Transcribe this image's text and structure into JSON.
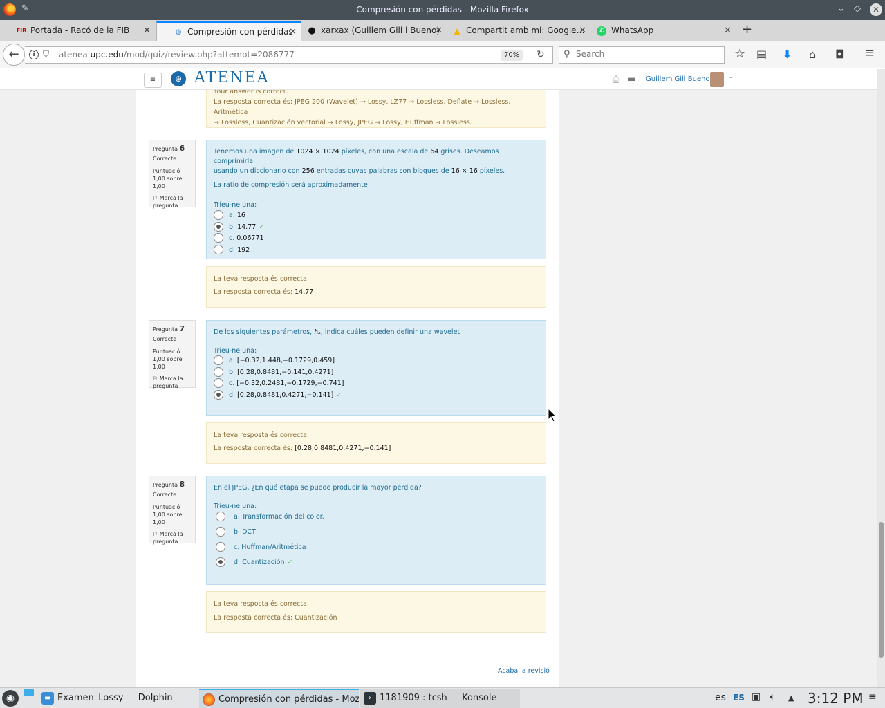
{
  "window": {
    "title": "Compresión con pérdidas - Mozilla Firefox"
  },
  "tabs": [
    {
      "label": "Portada - Racó de la FIB",
      "icon": "fib-icon"
    },
    {
      "label": "Compresión con pérdidas",
      "icon": "globe-icon"
    },
    {
      "label": "xarxax (Guillem Gili i Bueno)",
      "icon": "github-icon"
    },
    {
      "label": "Compartit amb mi: Google…",
      "icon": "google-drive-icon"
    },
    {
      "label": "WhatsApp",
      "icon": "whatsapp-icon"
    }
  ],
  "navbar": {
    "url_prefix": "atenea.",
    "url_domain": "upc.edu",
    "url_path": "/mod/quiz/review.php?attempt=2086777",
    "zoom": "70%",
    "search_placeholder": "Search"
  },
  "moodle": {
    "menu_icon": "≡",
    "logo_text": "ATENEA",
    "user_name": "Guillem Gili Bueno",
    "caret": "-"
  },
  "prev_feedback": {
    "line1": "Your answer is correct.",
    "line2": "La resposta correcta és: JPEG 200 (Wavelet)  → Lossy, LZ77 → Lossless, Deflate → Lossless, Aritmética",
    "line3": "→ Lossless, Cuantización vectorial → Lossy, JPEG → Lossy, Huffman → Lossless."
  },
  "questions": [
    {
      "label": "Pregunta",
      "number": "6",
      "state": "Correcte",
      "grade": "Puntuació 1,00 sobre 1,00",
      "flag": "Marca la pregunta",
      "text_parts": [
        "Tenemos una imagen de ",
        "1024 × 1024",
        " píxeles, con una escala de ",
        "64",
        " grises. Deseamos comprimirla",
        "usando un diccionario con ",
        "256",
        " entradas cuyas palabras son bloques de ",
        "16 × 16",
        " píxeles."
      ],
      "text2": "La ratio de compresión será aproximadamente",
      "prompt": "Trieu-ne una:",
      "options": [
        {
          "letter": "a.",
          "text": "16",
          "checked": false,
          "correct": false
        },
        {
          "letter": "b.",
          "text": "14.77",
          "checked": true,
          "correct": true
        },
        {
          "letter": "c.",
          "text": "0.06771",
          "checked": false,
          "correct": false
        },
        {
          "letter": "d.",
          "text": "192",
          "checked": false,
          "correct": false
        }
      ],
      "feedback1": "La teva resposta és correcta.",
      "feedback2_label": "La resposta correcta és:",
      "feedback2_value": "14.77"
    },
    {
      "label": "Pregunta",
      "number": "7",
      "state": "Correcte",
      "grade": "Puntuació 1,00 sobre 1,00",
      "flag": "Marca la pregunta",
      "text_a": "De los siguientes parámetros, ",
      "text_math": "hₖ",
      "text_b": ", indica cuáles pueden definir una wavelet",
      "prompt": "Trieu-ne una:",
      "options": [
        {
          "letter": "a.",
          "text": "[−0.32,1.448,−0.1729,0.459]",
          "checked": false,
          "correct": false
        },
        {
          "letter": "b.",
          "text": "[0.28,0.8481,−0.141,0.4271]",
          "checked": false,
          "correct": false
        },
        {
          "letter": "c.",
          "text": "[−0.32,0.2481,−0.1729,−0.741]",
          "checked": false,
          "correct": false
        },
        {
          "letter": "d.",
          "text": "[0.28,0.8481,0.4271,−0.141]",
          "checked": true,
          "correct": true
        }
      ],
      "feedback1": "La teva resposta és correcta.",
      "feedback2_label": "La resposta correcta és:",
      "feedback2_value": "[0.28,0.8481,0.4271,−0.141]"
    },
    {
      "label": "Pregunta",
      "number": "8",
      "state": "Correcte",
      "grade": "Puntuació 1,00 sobre 1,00",
      "flag": "Marca la pregunta",
      "text": "En el JPEG, ¿En qué etapa se puede producir la mayor pérdida?",
      "prompt": "Trieu-ne una:",
      "options": [
        {
          "letter": "a.",
          "text": "Transformación del color.",
          "checked": false,
          "correct": false
        },
        {
          "letter": "b.",
          "text": "DCT",
          "checked": false,
          "correct": false
        },
        {
          "letter": "c.",
          "text": "Huffman/Aritmética",
          "checked": false,
          "correct": false
        },
        {
          "letter": "d.",
          "text": "Cuantización",
          "checked": true,
          "correct": true
        }
      ],
      "feedback1": "La teva resposta és correcta.",
      "feedback2": "La resposta correcta és: Cuantización"
    }
  ],
  "finish_link": "Acaba la revisió",
  "taskbar": {
    "tasks": [
      {
        "label": "Examen_Lossy — Dolphin",
        "icon": "folder-icon"
      },
      {
        "label": "Compresión con pérdidas - Mozill...",
        "icon": "firefox-icon"
      },
      {
        "label": "1181909 : tcsh — Konsole",
        "icon": "terminal-icon"
      }
    ],
    "lang": "es",
    "kbd": "ES",
    "clock": "3:12 PM"
  },
  "colors": {
    "formulation_bg": "#dcedf6",
    "feedback_bg": "#fcf8e3",
    "link": "#1a6aa9",
    "tick": "#5cb85c"
  }
}
